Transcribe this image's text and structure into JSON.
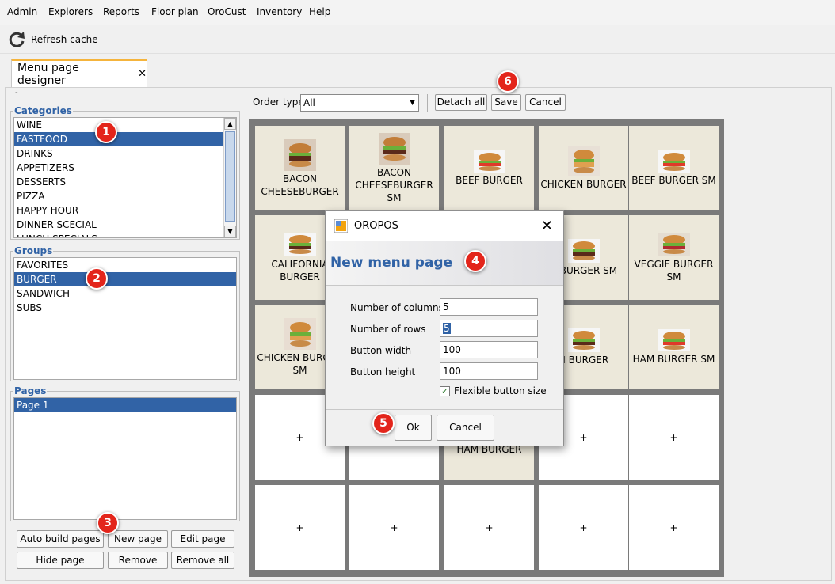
{
  "menubar": {
    "items": [
      "Admin",
      "Explorers",
      "Reports",
      "Floor plan",
      "OroCust",
      "Inventory",
      "Help"
    ]
  },
  "toolbar": {
    "refresh_label": "Refresh cache"
  },
  "tab": {
    "label": "Menu page designer",
    "close": "✕"
  },
  "panel_dash": "-",
  "categories": {
    "legend": "Categories",
    "items": [
      "WINE",
      "FASTFOOD",
      "DRINKS",
      "APPETIZERS",
      "DESSERTS",
      "PIZZA",
      "HAPPY HOUR",
      "DINNER SCECIAL",
      "LUNCH SPECIALS"
    ],
    "selected": "FASTFOOD"
  },
  "groups": {
    "legend": "Groups",
    "items": [
      "FAVORITES",
      "BURGER",
      "SANDWICH",
      "SUBS"
    ],
    "selected": "BURGER"
  },
  "pages": {
    "legend": "Pages",
    "items": [
      "Page 1"
    ],
    "selected": "Page 1"
  },
  "page_buttons": {
    "auto_build": "Auto build pages",
    "new_page": "New page",
    "edit_page": "Edit page",
    "hide_page": "Hide page",
    "remove": "Remove",
    "remove_all": "Remove all"
  },
  "order_bar": {
    "label": "Order type",
    "value": "All",
    "detach_all": "Detach all",
    "save": "Save",
    "cancel": "Cancel"
  },
  "grid": {
    "row1": [
      "BACON CHEESEBURGER",
      "BACON CHEESEBURGER SM",
      "BEEF BURGER",
      "CHICKEN BURGER",
      "BEEF BURGER SM"
    ],
    "row2": [
      "CALIFORNIA BURGER",
      "H BURGER SM",
      "VEGGIE BURGER SM"
    ],
    "row3": [
      "CHICKEN BURGER SM",
      "H BURGER",
      "HAM BURGER SM"
    ],
    "row4_item": "HAM BURGER",
    "plus": "+"
  },
  "dialog": {
    "title": "OROPOS",
    "close": "✕",
    "heading": "New menu page",
    "columns_label": "Number of columns",
    "columns_value": "5",
    "rows_label": "Number of rows",
    "rows_value": "5",
    "width_label": "Button width",
    "width_value": "100",
    "height_label": "Button height",
    "height_value": "100",
    "flexible_label": "Flexible button size",
    "flexible_checked": true,
    "ok": "Ok",
    "cancel": "Cancel"
  },
  "markers": [
    "1",
    "2",
    "3",
    "4",
    "5",
    "6"
  ],
  "colors": {
    "selection": "#3163a6",
    "marker": "#e3251b",
    "item_bg": "#ece8da",
    "tab_accent": "#f5b43c"
  }
}
